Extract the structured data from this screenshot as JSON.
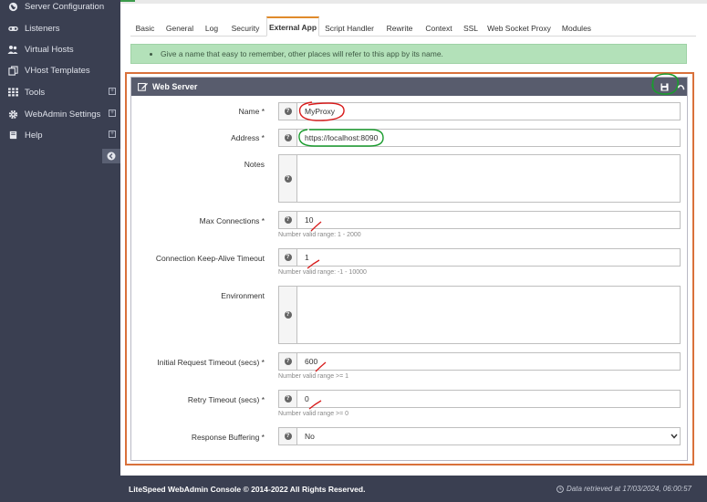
{
  "sidebar": {
    "items": [
      {
        "label": "Server Configuration",
        "icon": "globe-icon"
      },
      {
        "label": "Listeners",
        "icon": "link-icon"
      },
      {
        "label": "Virtual Hosts",
        "icon": "users-icon"
      },
      {
        "label": "VHost Templates",
        "icon": "copy-icon"
      },
      {
        "label": "Tools",
        "icon": "grid-icon"
      },
      {
        "label": "WebAdmin Settings",
        "icon": "gear-icon"
      },
      {
        "label": "Help",
        "icon": "book-icon"
      }
    ]
  },
  "tabs": [
    {
      "label": "Basic"
    },
    {
      "label": "General"
    },
    {
      "label": "Log"
    },
    {
      "label": "Security"
    },
    {
      "label": "External App",
      "active": true
    },
    {
      "label": "Script Handler"
    },
    {
      "label": "Rewrite"
    },
    {
      "label": "Context"
    },
    {
      "label": "SSL"
    },
    {
      "label": "Web Socket Proxy"
    },
    {
      "label": "Modules"
    }
  ],
  "info": {
    "text": "Give a name that easy to remember, other places will refer to this app by its name."
  },
  "panel": {
    "title": "Web Server"
  },
  "form": {
    "name": {
      "label": "Name *",
      "value": "MyProxy"
    },
    "address": {
      "label": "Address *",
      "value": "https://localhost:8090"
    },
    "notes": {
      "label": "Notes",
      "value": ""
    },
    "max_connections": {
      "label": "Max Connections *",
      "value": "10",
      "hint": "Number valid range: 1 - 2000"
    },
    "keep_alive": {
      "label": "Connection Keep-Alive Timeout",
      "value": "1",
      "hint": "Number valid range: -1 - 10000"
    },
    "environment": {
      "label": "Environment",
      "value": ""
    },
    "initial_timeout": {
      "label": "Initial Request Timeout (secs) *",
      "value": "600",
      "hint": "Number valid range >= 1"
    },
    "retry_timeout": {
      "label": "Retry Timeout (secs) *",
      "value": "0",
      "hint": "Number valid range >= 0"
    },
    "response_buffering": {
      "label": "Response Buffering *",
      "value": "No"
    }
  },
  "footer": {
    "copyright": "LiteSpeed WebAdmin Console © 2014-2022 All Rights Reserved.",
    "retrieved": "Data retrieved at 17/03/2024, 06:00:57"
  },
  "colors": {
    "sidebar_bg": "#3a3f51",
    "panel_header": "#585c6d",
    "info_bg": "#b3e1b9",
    "active_tab_accent": "#e08a2b",
    "frame_border": "#d9713b",
    "annotation_red": "#d81c1c",
    "annotation_green": "#1a9c2e"
  }
}
